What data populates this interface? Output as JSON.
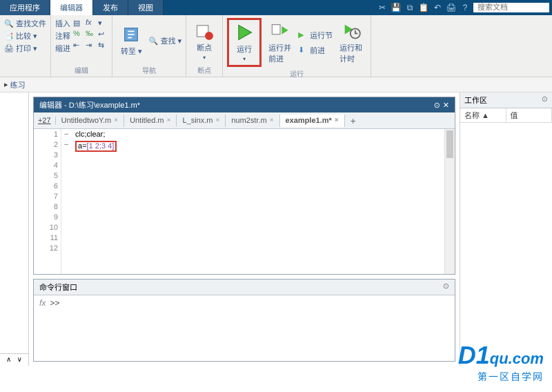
{
  "menu_tabs": [
    "应用程序",
    "编辑器",
    "发布",
    "视图"
  ],
  "active_menu_tab": 1,
  "search_placeholder": "搜索文档",
  "ribbon": {
    "group1": {
      "items": [
        "查找文件",
        "比较 ▾",
        "打印 ▾"
      ]
    },
    "group2": {
      "col1": [
        "插入",
        "注释",
        "缩进"
      ],
      "label": "编辑"
    },
    "group3": {
      "goto": "转至 ▾",
      "find": "查找 ▾",
      "label": "导航"
    },
    "group4": {
      "btn": "断点",
      "label": "断点"
    },
    "group5": {
      "run": "运行",
      "run_advance": "运行并\n前进",
      "run_section": "运行节",
      "advance": "前进",
      "run_time": "运行和\n计时",
      "label": "运行"
    }
  },
  "path": {
    "prefix": "▸",
    "item": "练习"
  },
  "editor": {
    "title": "编辑器 - D:\\练习\\example1.m*",
    "plus_tab": "+27",
    "tabs": [
      {
        "label": "UntitledtwoY.m"
      },
      {
        "label": "Untitled.m"
      },
      {
        "label": "L_sinx.m"
      },
      {
        "label": "num2str.m"
      },
      {
        "label": "example1.m*",
        "active": true
      }
    ],
    "lines": [
      "1",
      "2",
      "3",
      "4",
      "5",
      "6",
      "7",
      "8",
      "9",
      "10",
      "11",
      "12"
    ],
    "code_line1": "clc;clear;",
    "code_line2_var": "a=",
    "code_line2_val": "[1 2;3 4]"
  },
  "cmd": {
    "title": "命令行窗口",
    "prompt": ">>",
    "fx": "fx"
  },
  "workspace": {
    "title": "工作区",
    "col1": "名称 ▲",
    "col2": "值"
  },
  "watermark": {
    "brand": "D1",
    "domain": "qu.com",
    "sub": "第一区自学网"
  }
}
